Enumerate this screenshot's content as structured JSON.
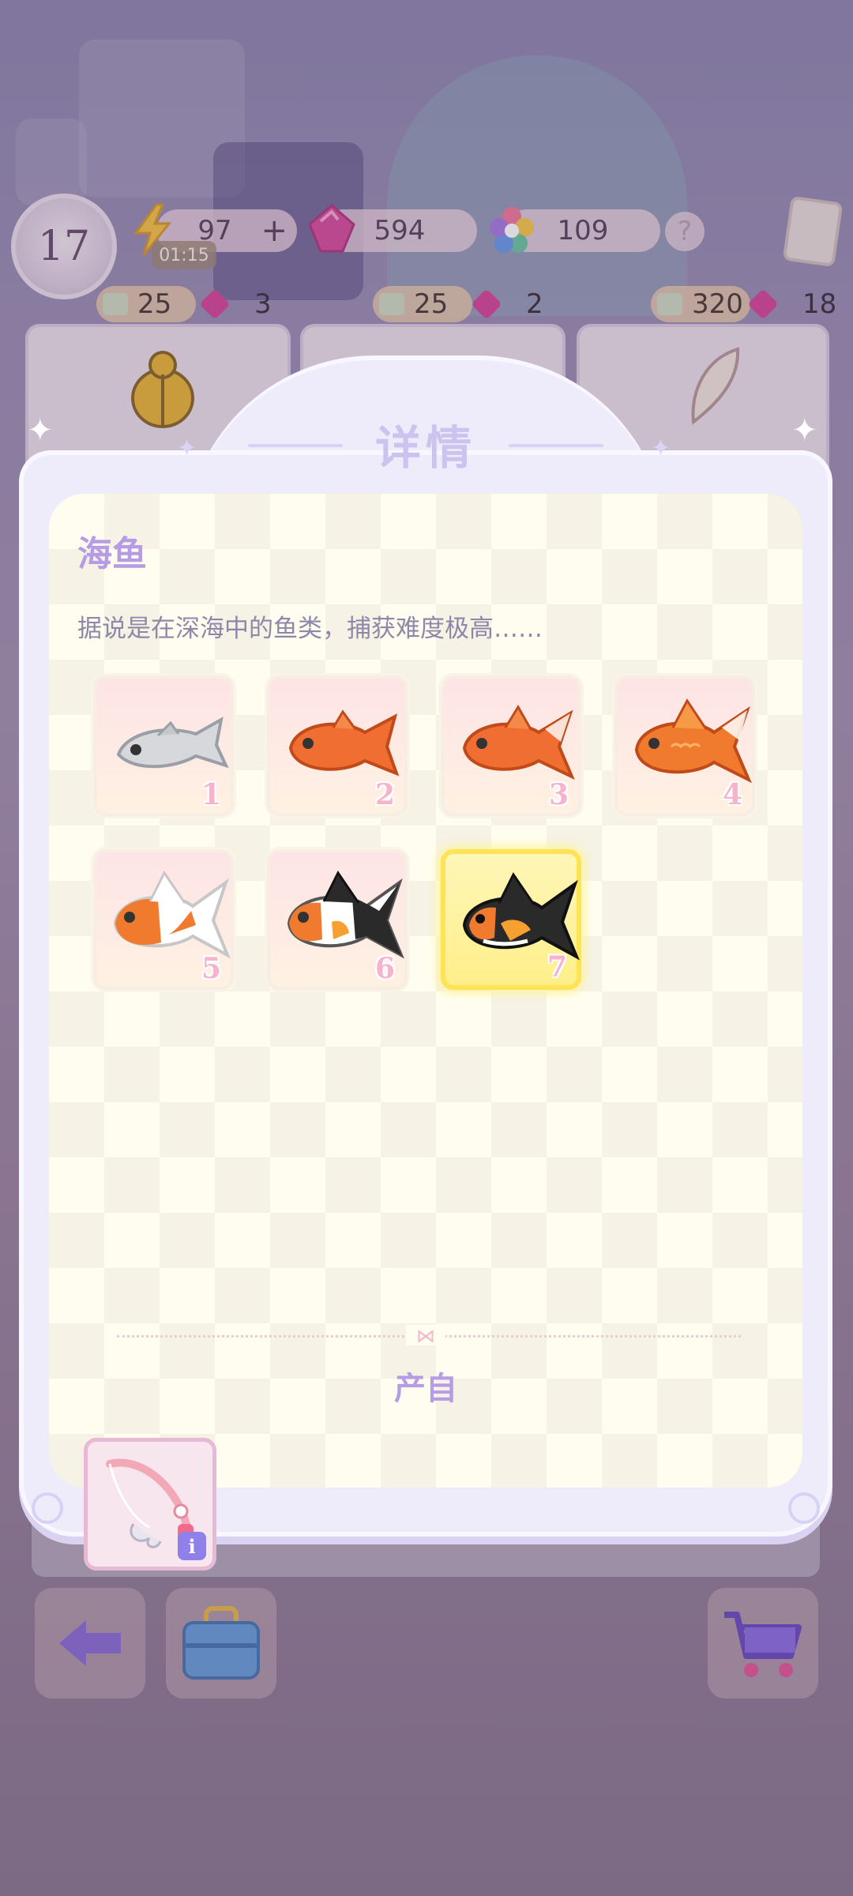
{
  "hud": {
    "level": "17",
    "energy": "97",
    "energy_plus": "+",
    "energy_timer": "01:15",
    "gems": "594",
    "stars": "109",
    "help": "?"
  },
  "shop_row": [
    {
      "tickets": "25",
      "gems": "3"
    },
    {
      "tickets": "25",
      "gems": "2"
    },
    {
      "tickets": "320",
      "gems": "18"
    }
  ],
  "modal": {
    "title": "详情",
    "item_name": "海鱼",
    "item_description": "据说是在深海中的鱼类，捕获难度极高……",
    "evolution": [
      {
        "level": "1",
        "icon": "silver-fish-icon"
      },
      {
        "level": "2",
        "icon": "orange-fish-icon"
      },
      {
        "level": "3",
        "icon": "orange-goldfish-icon"
      },
      {
        "level": "4",
        "icon": "fancy-goldfish-icon"
      },
      {
        "level": "5",
        "icon": "white-orange-goldfish-icon"
      },
      {
        "level": "6",
        "icon": "calico-goldfish-icon"
      },
      {
        "level": "7",
        "icon": "black-goldfish-icon",
        "selected": true
      }
    ],
    "source_label": "产自",
    "source_item_icon": "fishing-rod-icon",
    "info_glyph": "i"
  },
  "colors": {
    "modal_bg": "#eeebfb",
    "title": "#cdc3ef",
    "accent_text": "#b69ce4",
    "selected_tile": "#ffe357"
  }
}
